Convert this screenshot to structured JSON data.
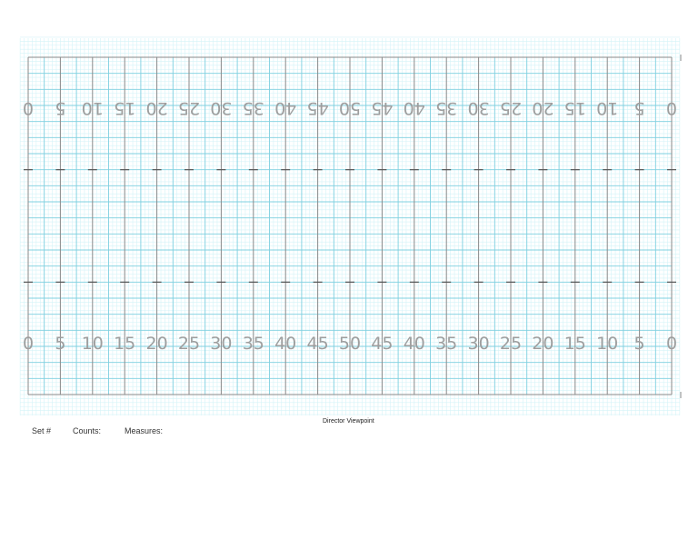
{
  "field": {
    "yard_labels": [
      "0",
      "5",
      "10",
      "15",
      "20",
      "25",
      "30",
      "35",
      "40",
      "45",
      "50",
      "45",
      "40",
      "35",
      "30",
      "25",
      "20",
      "15",
      "10",
      "5",
      "0"
    ],
    "hash_rows": 2,
    "colors": {
      "fine_grid": "#d4f3f8",
      "major_grid": "#7fd0e0",
      "yard_line": "#8a8a8a",
      "number": "#9e9e9e"
    }
  },
  "footer": {
    "viewpoint": "Director Viewpoint",
    "set_label": "Set #",
    "counts_label": "Counts:",
    "measures_label": "Measures:"
  }
}
